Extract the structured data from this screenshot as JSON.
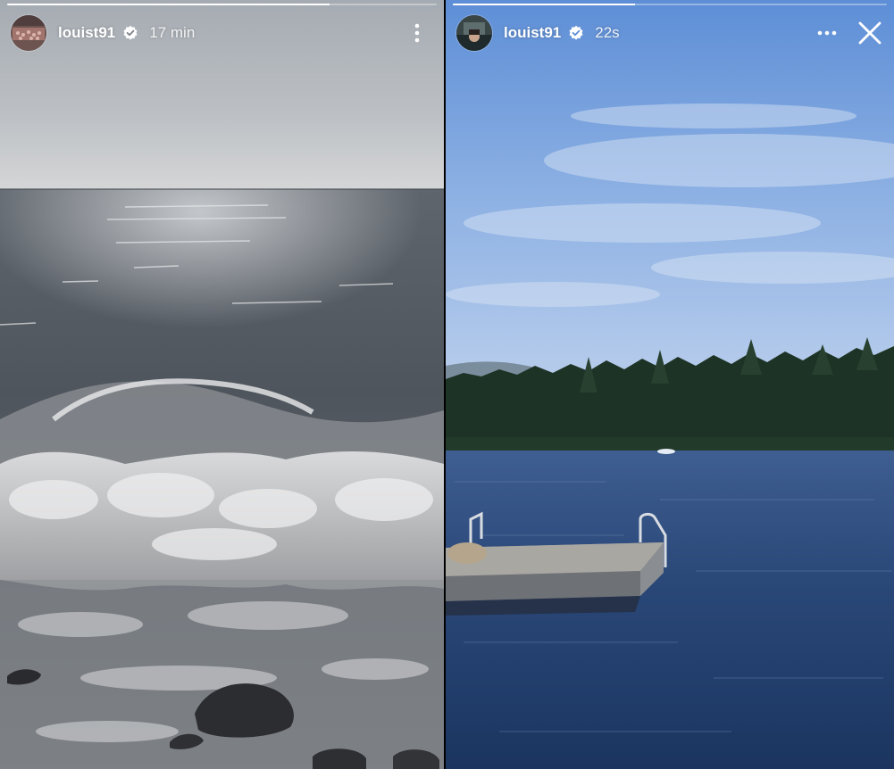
{
  "stories": [
    {
      "id": "left",
      "username": "louist91",
      "verified": true,
      "timestamp": "17 min",
      "progress": 0.75,
      "menu_icon": "more-vertical-icon",
      "image_subject": "ocean-waves"
    },
    {
      "id": "right",
      "username": "louist91",
      "verified": true,
      "timestamp": "22s",
      "progress": 0.42,
      "menu_icon": "more-horizontal-icon",
      "close_icon": "close-icon",
      "image_subject": "lake-dock"
    }
  ],
  "colors": {
    "ui_text": "#ffffff",
    "progress_track": "rgba(255,255,255,0.35)",
    "progress_fill": "#ffffff",
    "lake_water": "#1f3e6a",
    "sky_right": "#8fb2e4",
    "ocean_gray": "#6b7078"
  }
}
